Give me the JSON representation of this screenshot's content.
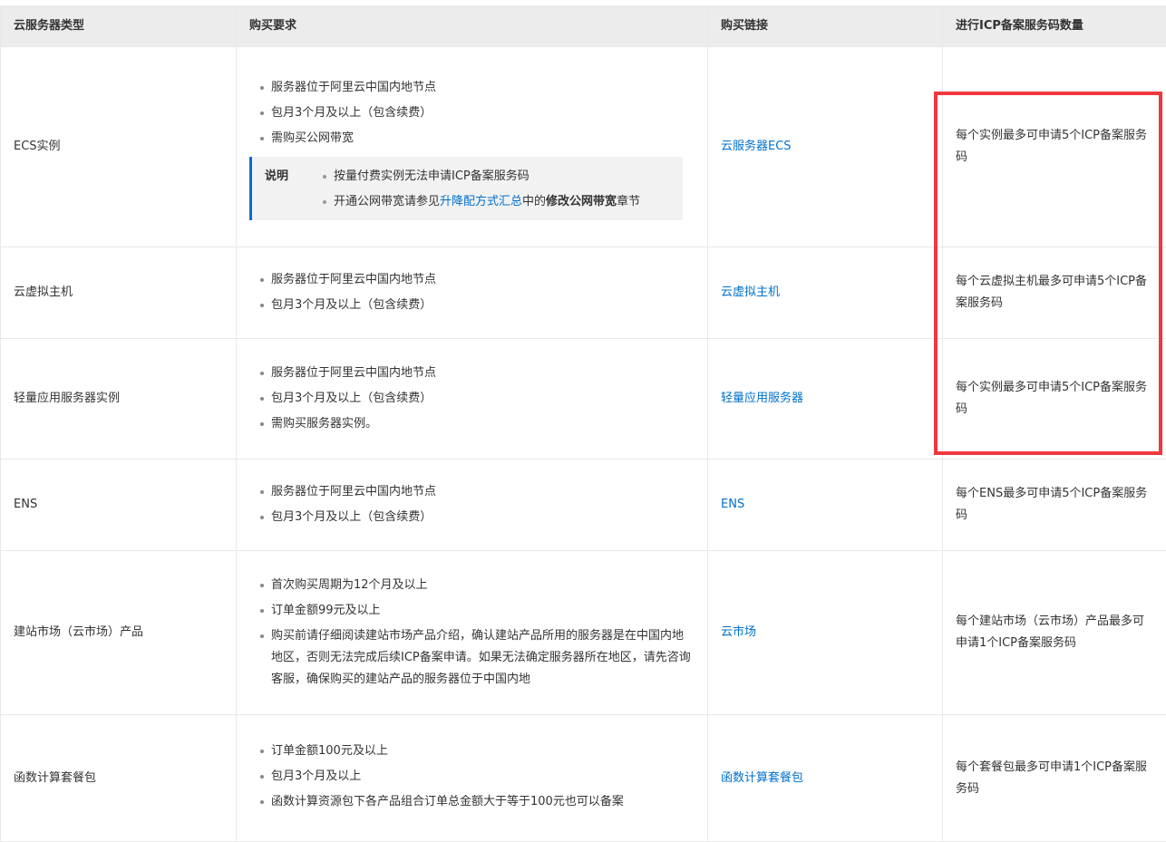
{
  "headers": [
    "云服务器类型",
    "购买要求",
    "购买链接",
    "进行ICP备案服务码数量"
  ],
  "rows": [
    {
      "type": "ECS实例",
      "requirements": [
        "服务器位于阿里云中国内地节点",
        "包月3个月及以上（包含续费）",
        "需购买公网带宽"
      ],
      "note": {
        "label": "说明",
        "item1": "按量付费实例无法申请ICP备案服务码",
        "item2_prefix": "开通公网带宽请参见",
        "item2_link": "升降配方式汇总",
        "item2_mid": "中的",
        "item2_bold": "修改公网带宽",
        "item2_suffix": "章节"
      },
      "link": "云服务器ECS",
      "count": "每个实例最多可申请5个ICP备案服务码"
    },
    {
      "type": "云虚拟主机",
      "requirements": [
        "服务器位于阿里云中国内地节点",
        "包月3个月及以上（包含续费）"
      ],
      "link": "云虚拟主机",
      "count": "每个云虚拟主机最多可申请5个ICP备案服务码"
    },
    {
      "type": "轻量应用服务器实例",
      "requirements": [
        "服务器位于阿里云中国内地节点",
        "包月3个月及以上（包含续费）",
        "需购买服务器实例。"
      ],
      "link": "轻量应用服务器",
      "count": "每个实例最多可申请5个ICP备案服务码"
    },
    {
      "type": "ENS",
      "requirements": [
        "服务器位于阿里云中国内地节点",
        "包月3个月及以上（包含续费）"
      ],
      "link": "ENS",
      "count": "每个ENS最多可申请5个ICP备案服务码"
    },
    {
      "type": "建站市场（云市场）产品",
      "requirements": [
        "首次购买周期为12个月及以上",
        "订单金额99元及以上",
        "购买前请仔细阅读建站市场产品介绍，确认建站产品所用的服务器是在中国内地地区，否则无法完成后续ICP备案申请。如果无法确定服务器所在地区，请先咨询客服，确保购买的建站产品的服务器位于中国内地"
      ],
      "link": "云市场",
      "count": "每个建站市场（云市场）产品最多可申请1个ICP备案服务码"
    },
    {
      "type": "函数计算套餐包",
      "requirements": [
        "订单金额100元及以上",
        "包月3个月及以上",
        "函数计算资源包下各产品组合订单总金额大于等于100元也可以备案"
      ],
      "link": "函数计算套餐包",
      "count": "每个套餐包最多可申请1个ICP备案服务码"
    }
  ],
  "highlight_color": "#f0383f",
  "link_color": "#0070cc"
}
